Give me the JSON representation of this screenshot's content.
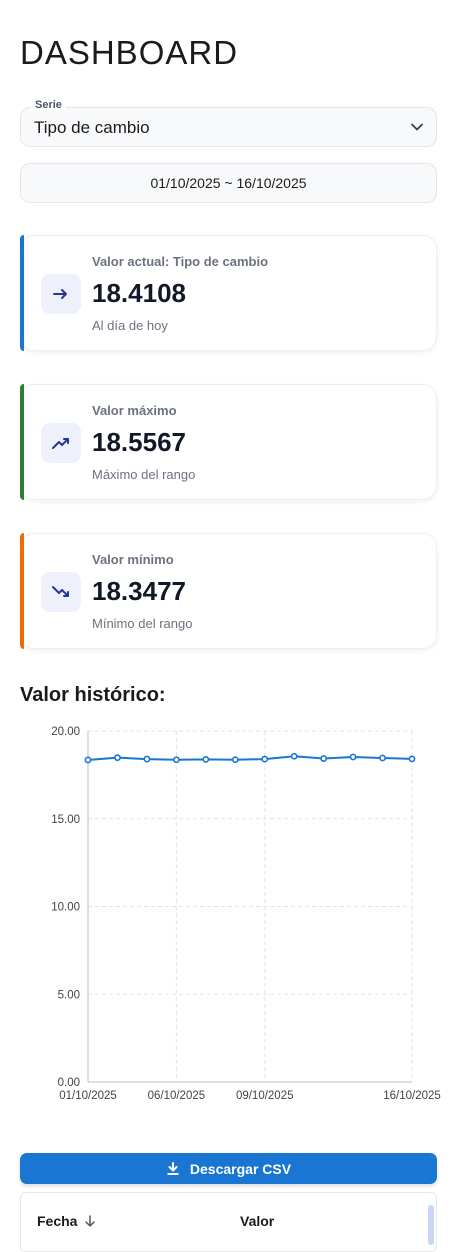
{
  "header": {
    "title": "DASHBOARD"
  },
  "filters": {
    "serie_label": "Serie",
    "serie_value": "Tipo de cambio",
    "date_range": "01/10/2025 ~ 16/10/2025"
  },
  "cards": [
    {
      "label": "Valor actual: Tipo de cambio",
      "value": "18.4108",
      "sub": "Al día de hoy",
      "icon": "arrow-right-icon",
      "accent": "#1976d2"
    },
    {
      "label": "Valor máximo",
      "value": "18.5567",
      "sub": "Máximo del rango",
      "icon": "trending-up-icon",
      "accent": "#2e7d32"
    },
    {
      "label": "Valor mínimo",
      "value": "18.3477",
      "sub": "Mínimo del rango",
      "icon": "trending-down-icon",
      "accent": "#ef6c00"
    }
  ],
  "chart_section": {
    "title": "Valor histórico:"
  },
  "chart_data": {
    "type": "line",
    "title": "",
    "xlabel": "",
    "ylabel": "",
    "ylim": [
      0,
      20
    ],
    "yticks": [
      "0.00",
      "5.00",
      "10.00",
      "15.00",
      "20.00"
    ],
    "xticks": [
      "01/10/2025",
      "06/10/2025",
      "09/10/2025",
      "16/10/2025"
    ],
    "x": [
      "01/10/2025",
      "02/10/2025",
      "03/10/2025",
      "06/10/2025",
      "07/10/2025",
      "08/10/2025",
      "09/10/2025",
      "10/10/2025",
      "13/10/2025",
      "14/10/2025",
      "15/10/2025",
      "16/10/2025"
    ],
    "series": [
      {
        "values": [
          18.35,
          18.48,
          18.4,
          18.36,
          18.38,
          18.36,
          18.4,
          18.56,
          18.43,
          18.52,
          18.46,
          18.41
        ],
        "color": "#1976d2"
      }
    ],
    "grid": true
  },
  "actions": {
    "csv_label": "Descargar CSV"
  },
  "table": {
    "columns": [
      "Fecha",
      "Valor"
    ]
  }
}
